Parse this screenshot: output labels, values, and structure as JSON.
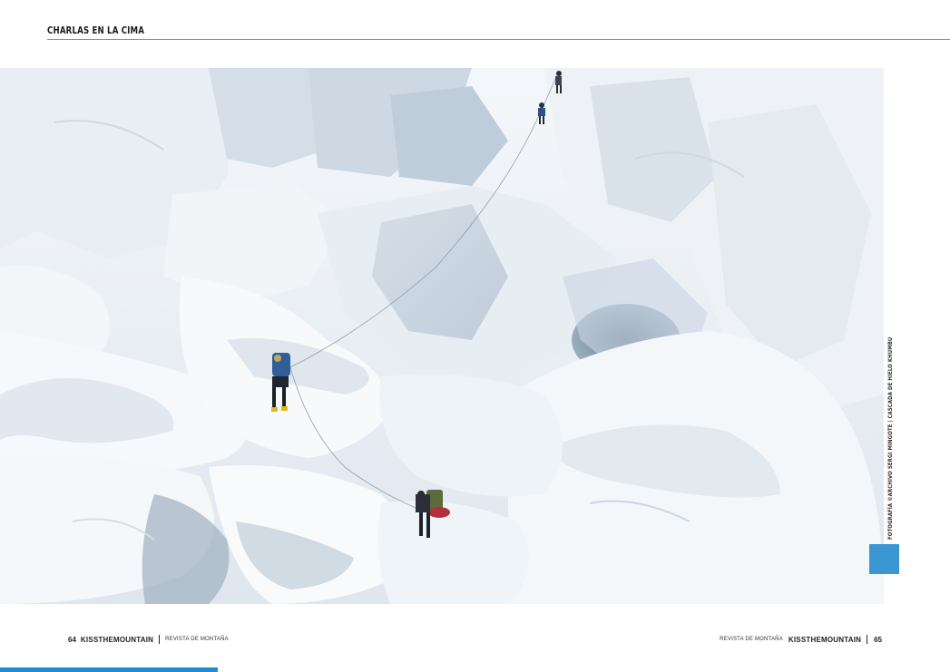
{
  "header": {
    "section_label": "CHARLAS EN LA CIMA"
  },
  "photo": {
    "description_icon": "icefall-photo",
    "credit": "FOTOGRAFÍA ©ARCHIVO SERGI MINGOTE | CASCADA DE HIELO KHUMBU"
  },
  "footer": {
    "left": {
      "page_number": "64",
      "brand": "KISSTHEMOUNTAIN",
      "magazine": "REVISTA DE MONTAÑA"
    },
    "right": {
      "magazine": "REVISTA DE MONTAÑA",
      "brand": "KISSTHEMOUNTAIN",
      "page_number": "65"
    }
  },
  "colors": {
    "accent": "#3a97d2",
    "bottom_bar": "#1f8ed0",
    "rule": "#8a8a8a"
  }
}
